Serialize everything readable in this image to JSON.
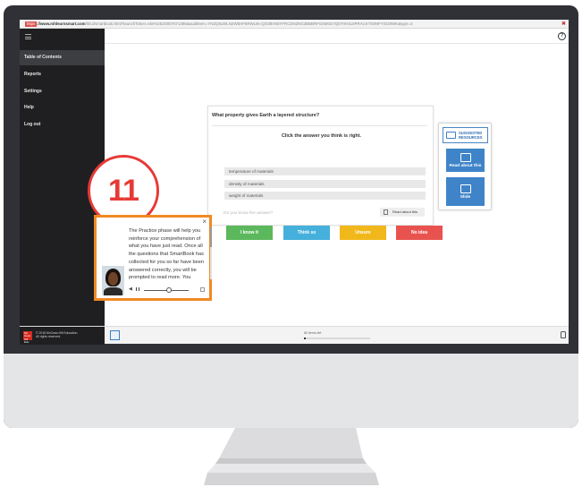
{
  "browser": {
    "https_label": "https",
    "domain": "://www.mhlearnsmart.com",
    "path": "/lti/ui/smartbook.html?launchToken=skn%252D007671386&auditItem=YNZQ5LWLNZWbHF6RWLW=QO3BV55YFRCDN2NG3BBBRFG6M6G7Q07HH3L8PRACKTS8NFYIO20WK&type=3"
  },
  "sidebar": {
    "items": [
      {
        "label": "Table of Contents",
        "active": true
      },
      {
        "label": "Reports",
        "active": false
      },
      {
        "label": "Settings",
        "active": false
      },
      {
        "label": "Help",
        "active": false
      },
      {
        "label": "Log out",
        "active": false
      }
    ]
  },
  "question": {
    "prompt": "What property gives Earth a layered structure?",
    "instruction": "Click the answer you think is right.",
    "choices": [
      "temperature of materials",
      "density of materials",
      "weight of materials"
    ],
    "know_prompt": "Do you know the answer?",
    "read_about_label": "Read about this"
  },
  "answers": [
    {
      "label": "I know it",
      "color": "#5cb85c"
    },
    {
      "label": "Think so",
      "color": "#46b0dc"
    },
    {
      "label": "Unsure",
      "color": "#f0b81b"
    },
    {
      "label": "No idea",
      "color": "#e9534f"
    }
  ],
  "resources": {
    "header": [
      "SUGGESTED",
      "RESOURCES"
    ],
    "read_label": "Read about this",
    "slide_label": "Slide"
  },
  "step_badge": "11",
  "popup": {
    "close": "×",
    "text": "The Practice phase will help you reinforce your comprehension of what you have just read. Once all the questions that SmartBook has collected for you so far have been answered correctly, you will be prompted to read more. You complete your assignment by",
    "audio_progress": 0.55
  },
  "footer": {
    "copyright_line1": "© 2018 McGraw-Hill Education.",
    "copyright_line2": "All rights reserved.",
    "logo_text": "Mc Graw Hill Edu",
    "progress_label": "80 items left",
    "progress": 0.03
  },
  "colors": {
    "badge_red": "#e63a36",
    "popup_orange": "#f08a24",
    "sidebar_bg": "#1f1f21",
    "resource_blue": "#3f84c8"
  }
}
